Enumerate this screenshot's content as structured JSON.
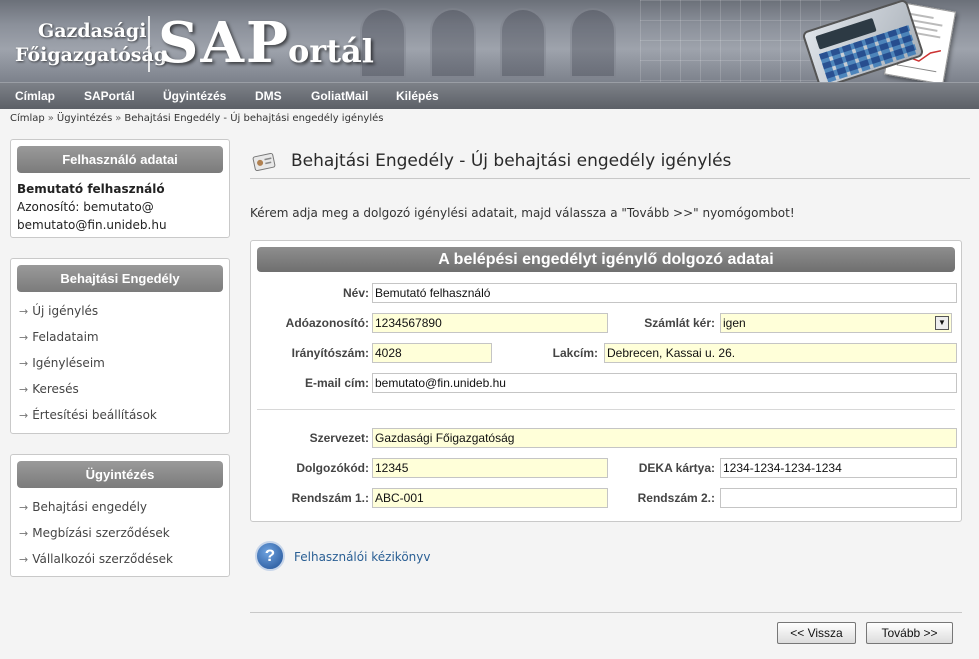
{
  "brand": {
    "line1": "Gazdasági",
    "line2": "Főigazgatóság",
    "logo_sa": "SA",
    "logo_p": "P",
    "logo_ortal": "ortál"
  },
  "topnav": [
    "Címlap",
    "SAPortál",
    "Ügyintézés",
    "DMS",
    "GoliatMail",
    "Kilépés"
  ],
  "breadcrumb": {
    "items": [
      "Címlap",
      "Ügyintézés",
      "Behajtási Engedély - Új behajtási engedély igénylés"
    ],
    "separator": "»"
  },
  "user_box": {
    "title": "Felhasználó adatai",
    "name": "Bemutató felhasználó",
    "id_line": "Azonosító: bemutato@",
    "email": "bemutato@fin.unideb.hu"
  },
  "permit_box": {
    "title": "Behajtási Engedély",
    "items": [
      "Új igénylés",
      "Feladataim",
      "Igényléseim",
      "Keresés",
      "Értesítési beállítások"
    ]
  },
  "admin_box": {
    "title": "Ügyintézés",
    "items": [
      "Behajtási engedély",
      "Megbízási szerződések",
      "Vállalkozói szerződések"
    ]
  },
  "main": {
    "title": "Behajtási Engedély - Új behajtási engedély igénylés",
    "instruction": "Kérem adja meg a dolgozó igénylési adatait, majd válassza a \"Tovább >>\" nyomógombot!"
  },
  "form": {
    "title": "A belépési engedélyt igénylő dolgozó adatai",
    "name_label": "Név:",
    "name_value": "Bemutató felhasználó",
    "tax_label": "Adóazonosító:",
    "tax_value": "1234567890",
    "invoice_label": "Számlát kér:",
    "invoice_value": "igen",
    "zip_label": "Irányítószám:",
    "zip_value": "4028",
    "address_label": "Lakcím:",
    "address_value": "Debrecen, Kassai u. 26.",
    "email_label": "E-mail cím:",
    "email_value": "bemutato@fin.unideb.hu",
    "org_label": "Szervezet:",
    "org_value": "Gazdasági Főigazgatóság",
    "empcode_label": "Dolgozókód:",
    "empcode_value": "12345",
    "deka_label": "DEKA kártya:",
    "deka_value": "1234-1234-1234-1234",
    "plate1_label": "Rendszám 1.:",
    "plate1_value": "ABC-001",
    "plate2_label": "Rendszám 2.:",
    "plate2_value": ""
  },
  "help": {
    "label": "Felhasználói kézikönyv",
    "icon_char": "?"
  },
  "buttons": {
    "back": "<< Vissza",
    "next": "Tovább >>"
  },
  "colors": {
    "required_field": "#ffffd9",
    "box_title": "#7b7b7b",
    "link": "#2a5f94"
  }
}
